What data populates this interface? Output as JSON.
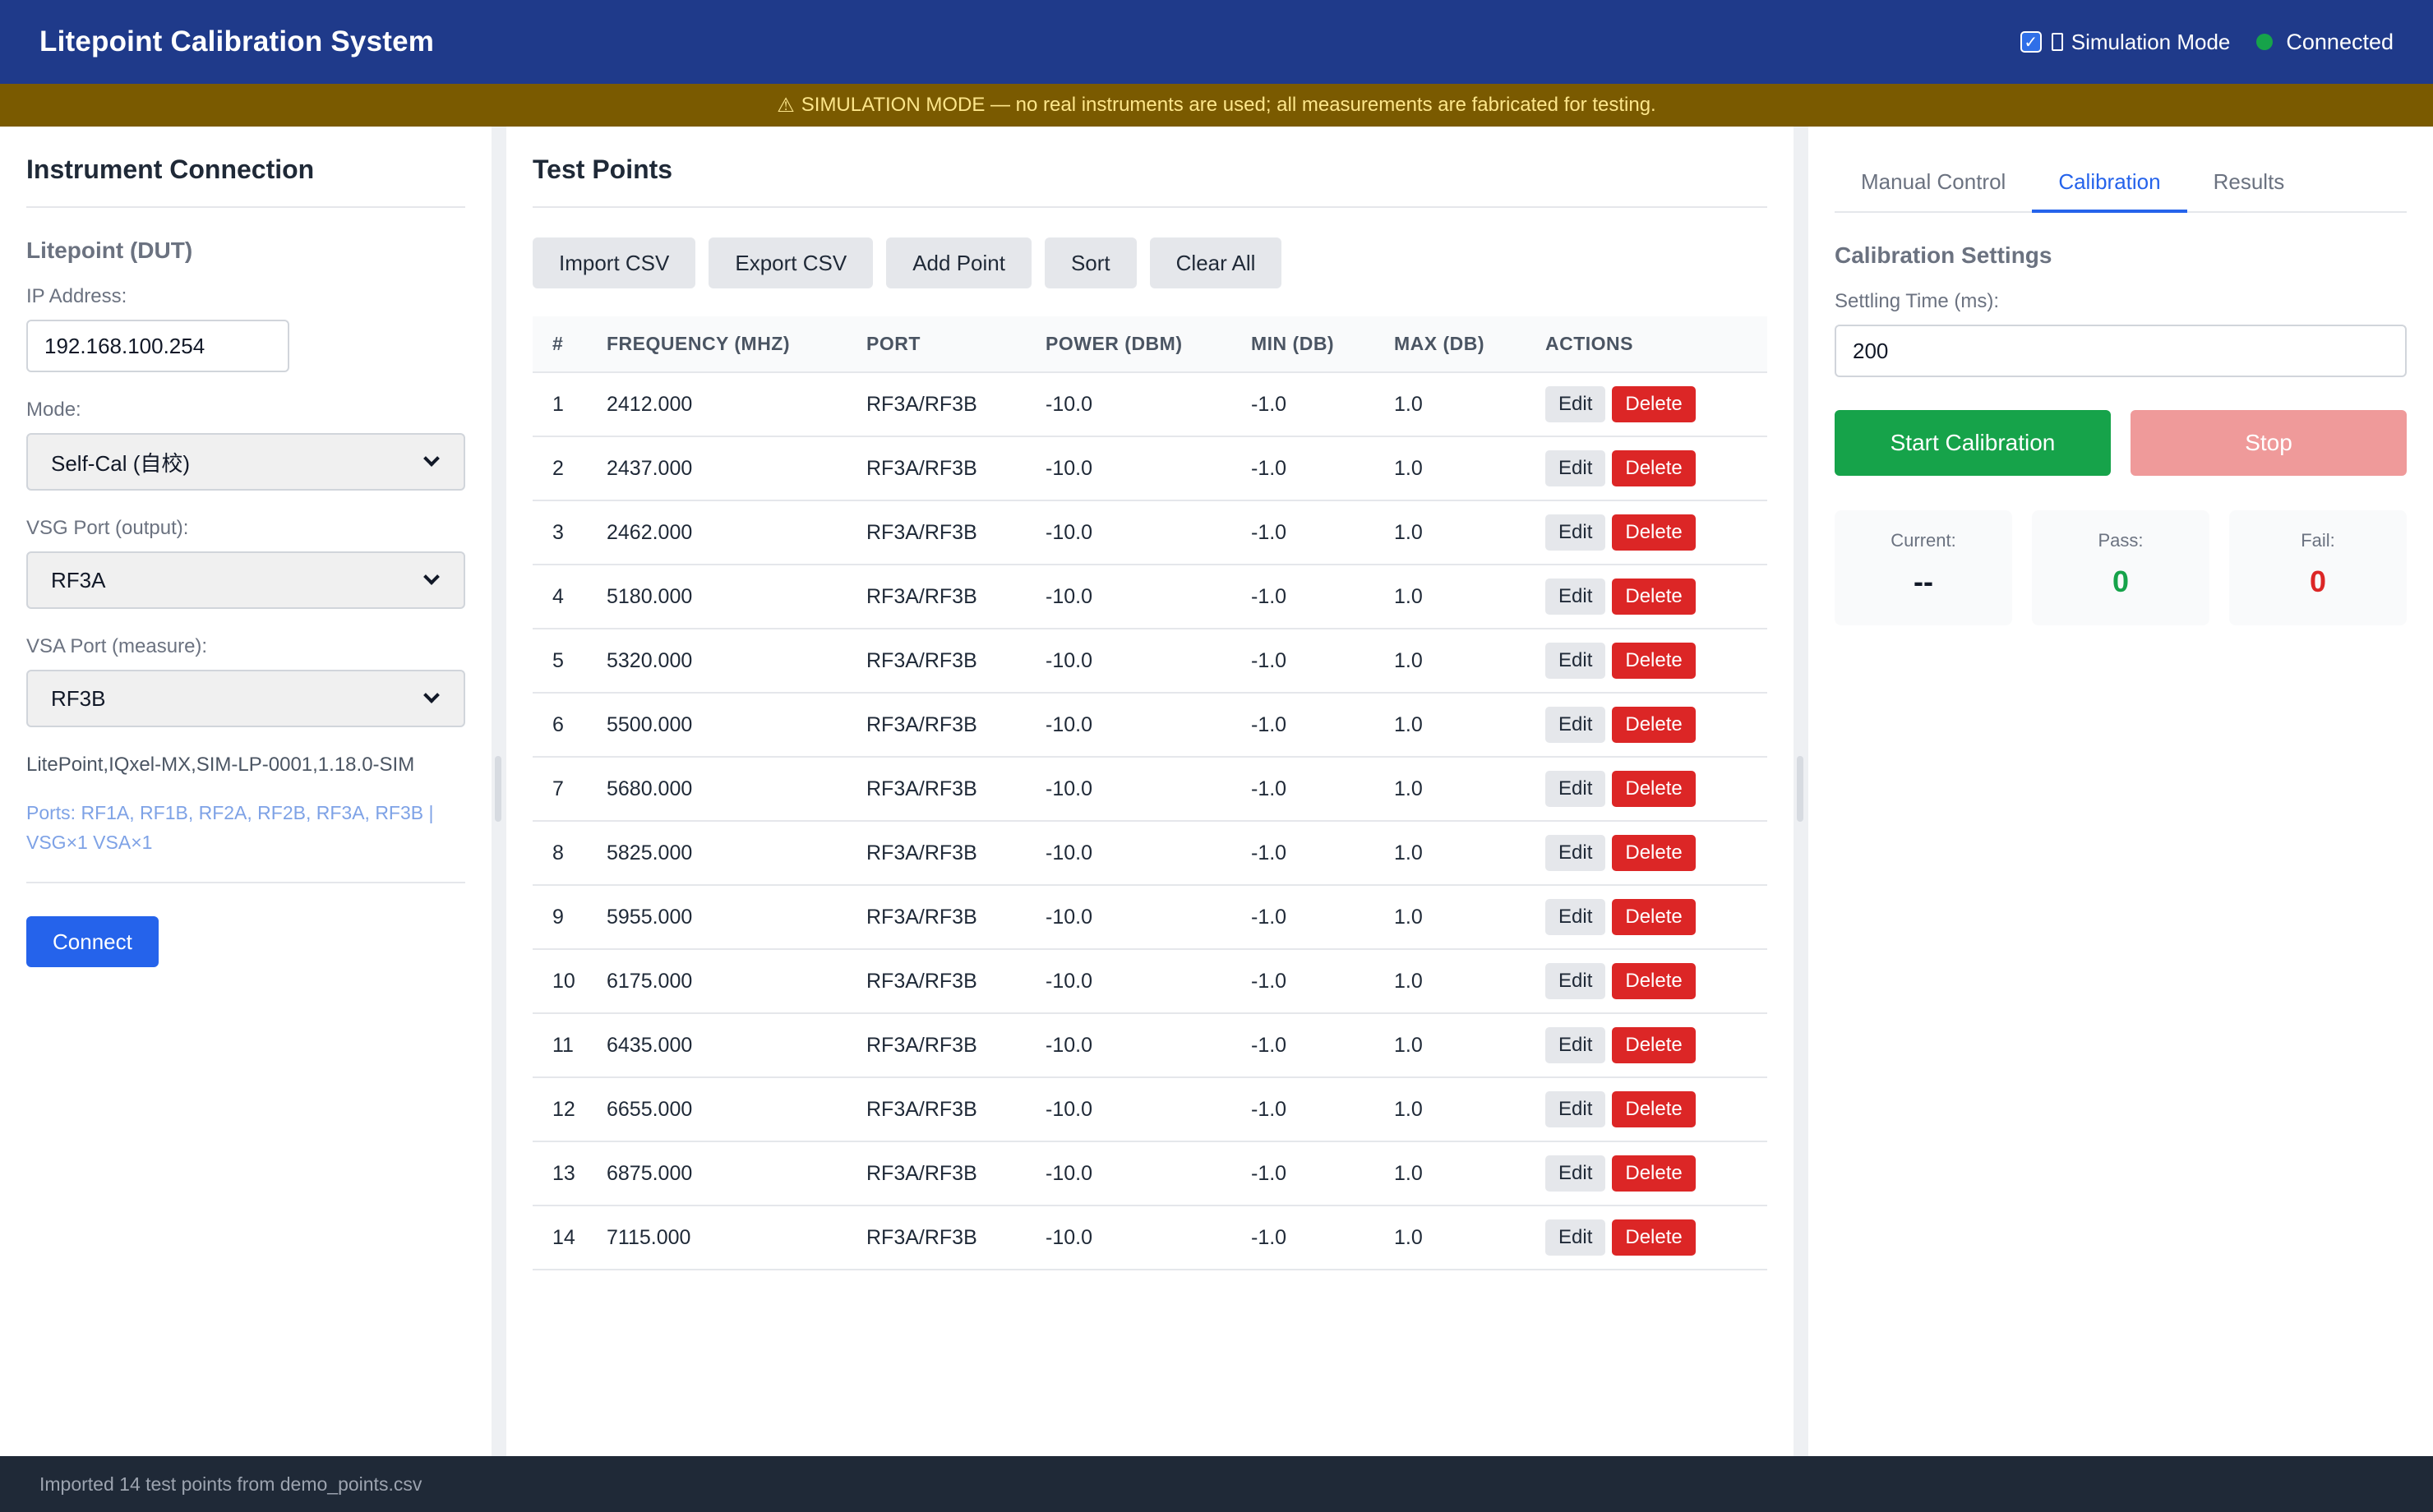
{
  "header": {
    "title": "Litepoint Calibration System",
    "simulation_label": "Simulation Mode",
    "connection_status": "Connected"
  },
  "banner": {
    "text": "SIMULATION MODE — no real instruments are used; all measurements are fabricated for testing."
  },
  "instrument": {
    "title": "Instrument Connection",
    "section": "Litepoint (DUT)",
    "ip_label": "IP Address:",
    "ip_value": "192.168.100.254",
    "mode_label": "Mode:",
    "mode_value": "Self-Cal (自校)",
    "vsg_label": "VSG Port (output):",
    "vsg_value": "RF3A",
    "vsa_label": "VSA Port (measure):",
    "vsa_value": "RF3B",
    "idn": "LitePoint,IQxel-MX,SIM-LP-0001,1.18.0-SIM",
    "ports": "Ports: RF1A, RF1B, RF2A, RF2B, RF3A, RF3B | VSG×1 VSA×1",
    "connect_label": "Connect"
  },
  "test_points": {
    "title": "Test Points",
    "toolbar": [
      "Import CSV",
      "Export CSV",
      "Add Point",
      "Sort",
      "Clear All"
    ],
    "columns": [
      "#",
      "FREQUENCY (MHZ)",
      "PORT",
      "POWER (DBM)",
      "MIN (DB)",
      "MAX (DB)",
      "ACTIONS"
    ],
    "edit_label": "Edit",
    "delete_label": "Delete",
    "rows": [
      {
        "n": "1",
        "freq": "2412.000",
        "port": "RF3A/RF3B",
        "power": "-10.0",
        "min": "-1.0",
        "max": "1.0"
      },
      {
        "n": "2",
        "freq": "2437.000",
        "port": "RF3A/RF3B",
        "power": "-10.0",
        "min": "-1.0",
        "max": "1.0"
      },
      {
        "n": "3",
        "freq": "2462.000",
        "port": "RF3A/RF3B",
        "power": "-10.0",
        "min": "-1.0",
        "max": "1.0"
      },
      {
        "n": "4",
        "freq": "5180.000",
        "port": "RF3A/RF3B",
        "power": "-10.0",
        "min": "-1.0",
        "max": "1.0"
      },
      {
        "n": "5",
        "freq": "5320.000",
        "port": "RF3A/RF3B",
        "power": "-10.0",
        "min": "-1.0",
        "max": "1.0"
      },
      {
        "n": "6",
        "freq": "5500.000",
        "port": "RF3A/RF3B",
        "power": "-10.0",
        "min": "-1.0",
        "max": "1.0"
      },
      {
        "n": "7",
        "freq": "5680.000",
        "port": "RF3A/RF3B",
        "power": "-10.0",
        "min": "-1.0",
        "max": "1.0"
      },
      {
        "n": "8",
        "freq": "5825.000",
        "port": "RF3A/RF3B",
        "power": "-10.0",
        "min": "-1.0",
        "max": "1.0"
      },
      {
        "n": "9",
        "freq": "5955.000",
        "port": "RF3A/RF3B",
        "power": "-10.0",
        "min": "-1.0",
        "max": "1.0"
      },
      {
        "n": "10",
        "freq": "6175.000",
        "port": "RF3A/RF3B",
        "power": "-10.0",
        "min": "-1.0",
        "max": "1.0"
      },
      {
        "n": "11",
        "freq": "6435.000",
        "port": "RF3A/RF3B",
        "power": "-10.0",
        "min": "-1.0",
        "max": "1.0"
      },
      {
        "n": "12",
        "freq": "6655.000",
        "port": "RF3A/RF3B",
        "power": "-10.0",
        "min": "-1.0",
        "max": "1.0"
      },
      {
        "n": "13",
        "freq": "6875.000",
        "port": "RF3A/RF3B",
        "power": "-10.0",
        "min": "-1.0",
        "max": "1.0"
      },
      {
        "n": "14",
        "freq": "7115.000",
        "port": "RF3A/RF3B",
        "power": "-10.0",
        "min": "-1.0",
        "max": "1.0"
      }
    ]
  },
  "calibration": {
    "tabs": [
      "Manual Control",
      "Calibration",
      "Results"
    ],
    "active_tab": "Calibration",
    "settings_title": "Calibration Settings",
    "settling_label": "Settling Time (ms):",
    "settling_value": "200",
    "start_label": "Start Calibration",
    "stop_label": "Stop",
    "current_label": "Current:",
    "current_value": "--",
    "pass_label": "Pass:",
    "pass_value": "0",
    "fail_label": "Fail:",
    "fail_value": "0"
  },
  "status_bar": {
    "text": "Imported 14 test points from demo_points.csv"
  },
  "colors": {
    "header_bg": "#1f3a8a",
    "banner_bg": "#7a5a00",
    "primary": "#2563eb",
    "success": "#16a34a",
    "danger": "#dc2626",
    "stop_disabled": "#ef9a9a"
  },
  "icons": {
    "banner": "warning-icon",
    "connection": "status-dot-icon",
    "select": "chevron-down-icon"
  }
}
